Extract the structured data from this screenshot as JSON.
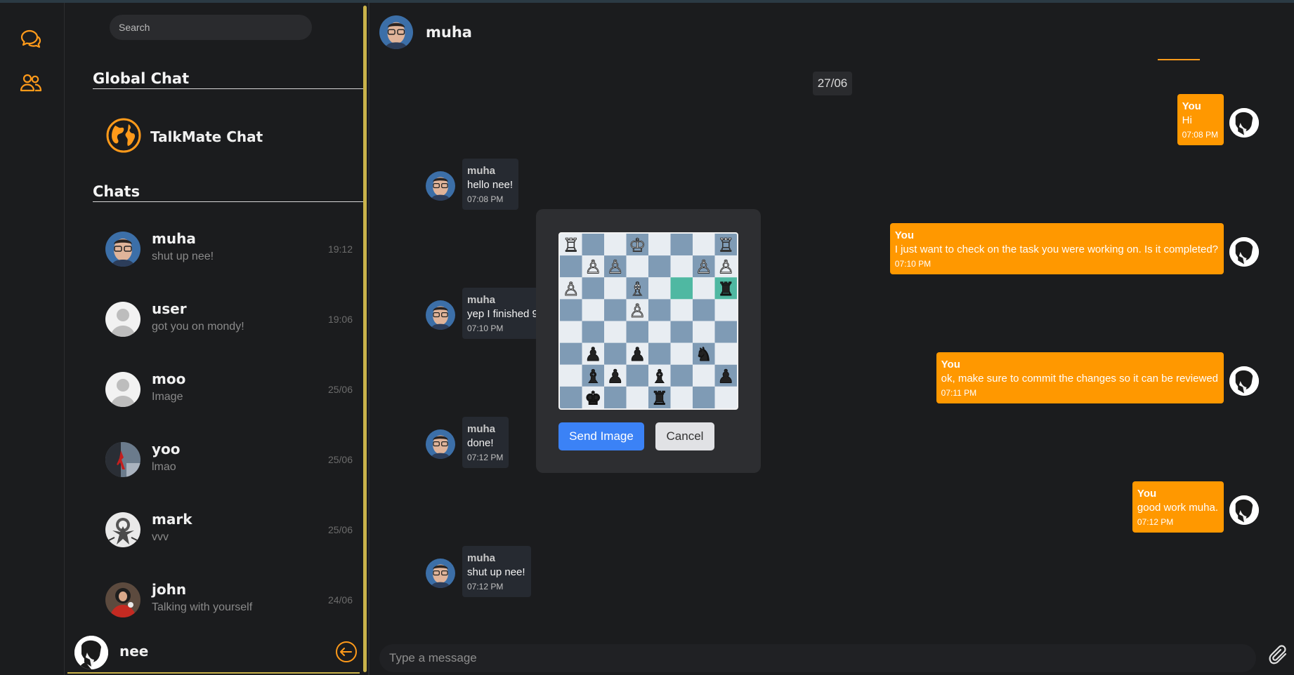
{
  "colors": {
    "accent": "#ff9800",
    "send_button": "#3b82f6",
    "background": "#1b1c1e"
  },
  "rail": {
    "chats_icon": "chat-bubbles-icon",
    "contacts_icon": "users-icon"
  },
  "search": {
    "placeholder": "Search"
  },
  "sections": {
    "global": "Global Chat",
    "chats": "Chats"
  },
  "global_chat": {
    "name": "TalkMate Chat",
    "icon": "globe-icon"
  },
  "chats": [
    {
      "name": "muha",
      "last": "shut up nee!",
      "time": "19:12"
    },
    {
      "name": "user",
      "last": "got you on mondy!",
      "time": "19:06"
    },
    {
      "name": "moo",
      "last": "Image",
      "time": "25/06"
    },
    {
      "name": "yoo",
      "last": "lmao",
      "time": "25/06"
    },
    {
      "name": "mark",
      "last": "vvv",
      "time": "25/06"
    },
    {
      "name": "john",
      "last": "Talking with yourself",
      "time": "24/06"
    }
  ],
  "me": {
    "name": "nee",
    "logout_icon": "logout-icon"
  },
  "conversation": {
    "title": "muha",
    "date": "27/06",
    "messages": [
      {
        "from": "You",
        "text": "Hi",
        "time": "07:08 PM"
      },
      {
        "from": "muha",
        "text": "hello nee!",
        "time": "07:08 PM"
      },
      {
        "from": "You",
        "text": "I just want to check on the task you were working on. Is it completed?",
        "time": "07:10 PM"
      },
      {
        "from": "muha",
        "text": "yep I finished 9",
        "time": "07:10 PM"
      },
      {
        "from": "You",
        "text": "ok, make sure to commit the changes so it can be reviewed",
        "time": "07:11 PM"
      },
      {
        "from": "muha",
        "text": "done!",
        "time": "07:12 PM"
      },
      {
        "from": "You",
        "text": "good work muha.",
        "time": "07:12 PM"
      },
      {
        "from": "muha",
        "text": "shut up nee!",
        "time": "07:12 PM"
      }
    ]
  },
  "composer": {
    "placeholder": "Type a message",
    "attach_icon": "paperclip-icon"
  },
  "modal": {
    "send_label": "Send Image",
    "cancel_label": "Cancel",
    "preview": "chessboard-image"
  }
}
